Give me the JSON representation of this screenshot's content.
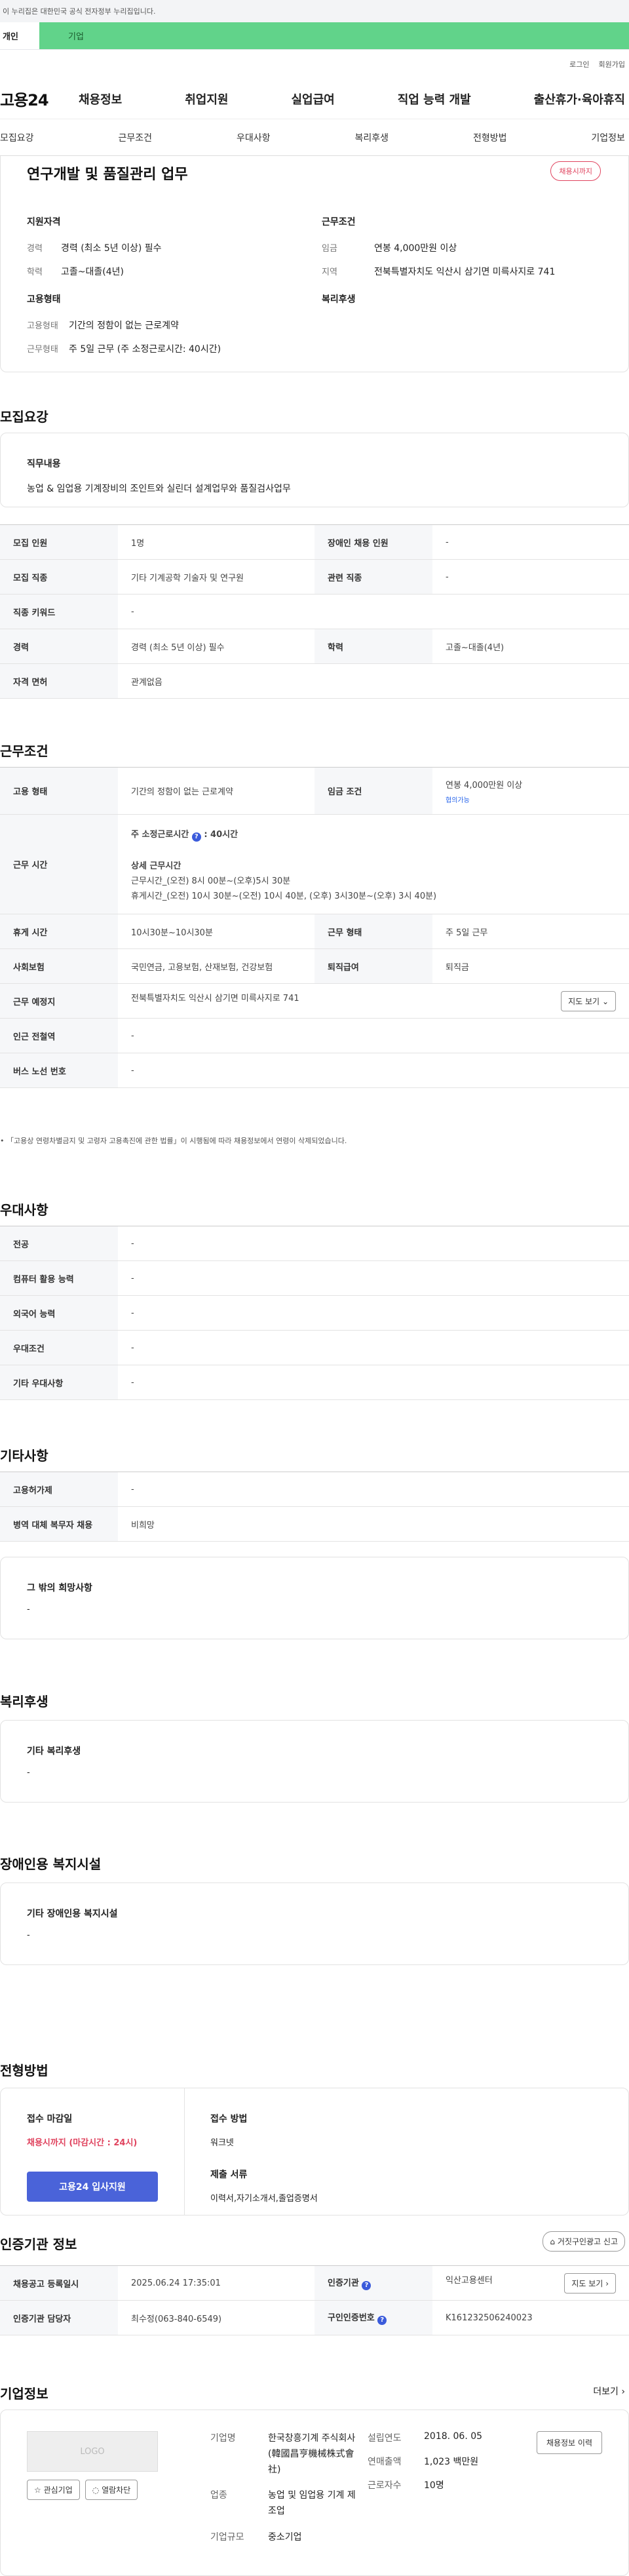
{
  "banner": {
    "text": "이 누리집은 대한민국 공식 전자정부 누리집입니다."
  },
  "user_tabs": [
    "개인",
    "기업"
  ],
  "util": {
    "login": "로그인",
    "join": "회원가입"
  },
  "gnb": {
    "logo": "고용24",
    "menu": [
      "채용정보",
      "취업지원",
      "실업급여",
      "직업 능력 개발",
      "출산휴가·육아휴직"
    ]
  },
  "anchor_tabs": [
    "모집요강",
    "근무조건",
    "우대사항",
    "복리후생",
    "전형방법",
    "기업정보"
  ],
  "summary": {
    "title": "연구개발 및 품질관리 업무",
    "badge": "채용시까지",
    "left": {
      "h1": "지원자격",
      "career_k": "경력",
      "career_v": "경력 (최소 5년 이상) 필수",
      "edu_k": "학력",
      "edu_v": "고졸~대졸(4년)",
      "h2": "고용형태",
      "type_k": "고용형태",
      "type_v": "기간의 정함이 없는 근로계약",
      "work_k": "근무형태",
      "work_v": "주 5일 근무 (주 소정근로시간: 40시간)"
    },
    "right": {
      "h1": "근무조건",
      "wage_k": "임금",
      "wage_v": "연봉 4,000만원 이상",
      "loc_k": "지역",
      "loc_v": "전북특별자치도 익산시 삼기면 미륵사지로 741",
      "h2": "복리후생"
    }
  },
  "recruit": {
    "title": "모집요강",
    "job_title": "직무내용",
    "job_desc": "농업 & 임업용 기계장비의 조인트와 실린더 설계업무와 품질검사업무",
    "rows": [
      [
        "모집 인원",
        "1명",
        "장애인 채용 인원",
        "-"
      ],
      [
        "모집 직종",
        "기타 기계공학 기술자 및 연구원",
        "관련 직종",
        "-"
      ],
      [
        "직종 키워드",
        "-"
      ],
      [
        "경력",
        "경력 (최소 5년 이상) 필수",
        "학력",
        "고졸~대졸(4년)"
      ],
      [
        "자격 면허",
        "관계없음"
      ]
    ]
  },
  "conditions": {
    "title": "근무조건",
    "type_h": "고용 형태",
    "type_v": "기간의 정함이 없는 근로계약",
    "wage_h": "임금 조건",
    "wage_v": "연봉 4,000만원 이상",
    "wage_badge": "협의가능",
    "hours_h": "근무 시간",
    "hours_week": "주 소정근로시간",
    "hours_week_v": ": 40시간",
    "hours_detail_t": "상세 근무시간",
    "hours_line1": "근무시간_(오전) 8시 00분~(오후)5시 30분",
    "hours_line2": "휴게시간_(오전) 10시 30분~(오전) 10시 40분,   (오후) 3시30분~(오후) 3시 40분)",
    "rest_h": "휴게 시간",
    "rest_v": "10시30분~10시30분",
    "form_h": "근무 형태",
    "form_v": "주 5일 근무",
    "ins_h": "사회보험",
    "ins_v": "국민연금, 고용보험, 산재보험, 건강보험",
    "sev_h": "퇴직급여",
    "sev_v": "퇴직금",
    "place_h": "근무 예정지",
    "place_v": "전북특별자치도 익산시 삼기면 미륵사지로 741",
    "map_btn": "지도 보기",
    "sub_h": "인근 전철역",
    "sub_v": "-",
    "bus_h": "버스 노선 번호",
    "bus_v": "-",
    "note": "「고용상 연령차별금지 및 고령자 고용촉진에 관한 법률」이 시행됨에 따라 채용정보에서 연령이 삭제되었습니다."
  },
  "prefer": {
    "title": "우대사항",
    "rows": [
      [
        "전공",
        "-"
      ],
      [
        "컴퓨터 활용 능력",
        "-"
      ],
      [
        "외국어 능력",
        "-"
      ],
      [
        "우대조건",
        "-"
      ],
      [
        "기타 우대사항",
        "-"
      ]
    ]
  },
  "etc": {
    "title": "기타사항",
    "rows": [
      [
        "고용허가제",
        "-"
      ],
      [
        "병역 대체 복무자 채용",
        "비희망"
      ]
    ],
    "hope_t": "그 밖의 희망사항",
    "hope_v": "-"
  },
  "welfare": {
    "title": "복리후생",
    "t": "기타 복리후생",
    "v": "-"
  },
  "disabled": {
    "title": "장애인용 복지시설",
    "t": "기타 장애인용 복지시설",
    "v": "-"
  },
  "process": {
    "title": "전형방법",
    "deadline_t": "접수 마감일",
    "deadline_v": "채용시까지 (마감시간 : 24시)",
    "apply_btn": "고용24 입사지원",
    "method_t": "접수 방법",
    "method_v": "워크넷",
    "docs_t": "제출 서류",
    "docs_v": "이력서,자기소개서,졸업증명서"
  },
  "cert": {
    "title": "인증기관 정보",
    "report_btn": "거짓구인광고 신고",
    "reg_h": "채용공고 등록일시",
    "reg_v": "2025.06.24 17:35:01",
    "org_h": "인증기관",
    "org_v": "익산고용센터",
    "map_btn": "지도 보기",
    "mgr_h": "인증기관 담당자",
    "mgr_v": "최수정(063-840-6549)",
    "no_h": "구인인증번호",
    "no_v": "K161232506240023"
  },
  "company": {
    "title": "기업정보",
    "more": "더보기",
    "logo": "LOGO",
    "fav": "관심기업",
    "block": "열람차단",
    "name_k": "기업명",
    "name_v": "한국창흥기계 주식회사(韓國昌亨機械株式會社)",
    "ind_k": "업종",
    "ind_v": "농업 및 임업용 기계 제조업",
    "size_k": "기업규모",
    "size_v": "중소기업",
    "est_k": "설립연도",
    "est_v": "2018. 06. 05",
    "sales_k": "연매출액",
    "sales_v": "1,023 백만원",
    "emp_k": "근로자수",
    "emp_v": "10명",
    "history_btn": "채용정보 이력"
  }
}
